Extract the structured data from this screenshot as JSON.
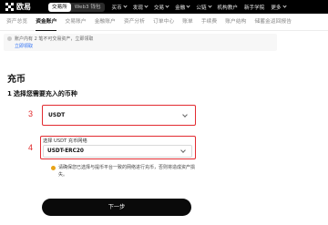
{
  "brand": {
    "name": "欧易"
  },
  "header": {
    "modes": [
      "交易所",
      "Web3 钱包"
    ],
    "nav": [
      {
        "label": "买币",
        "dropdown": true
      },
      {
        "label": "发现",
        "dropdown": true
      },
      {
        "label": "交易",
        "dropdown": true
      },
      {
        "label": "金融",
        "dropdown": true
      },
      {
        "label": "公链",
        "dropdown": true
      },
      {
        "label": "机构教户",
        "dropdown": false
      },
      {
        "label": "新手学院",
        "dropdown": false
      },
      {
        "label": "更多",
        "dropdown": true
      }
    ]
  },
  "subnav": {
    "items": [
      "资产总览",
      "资金账户",
      "交易账户",
      "金融账户",
      "资产分析",
      "订单中心",
      "账单",
      "手续费",
      "账户结构",
      "储蓄金返回报告"
    ],
    "active_index": 1
  },
  "notice": {
    "text": "账户内有 2 笔不可交易资产，立即领取",
    "link": "立即领取"
  },
  "page": {
    "title": "充币"
  },
  "step1": {
    "index": "1",
    "title": "选择您需要充入的币种"
  },
  "coin_select": {
    "value": "USDT"
  },
  "network": {
    "label": "选择 USDT 充币网络",
    "value": "USDT-ERC20"
  },
  "warning": {
    "text": "请确保您已选择与提币平台一致的网络进行充币，否则将造成资产损失。"
  },
  "next_button": {
    "label": "下一步"
  },
  "annotations": {
    "a3": "3",
    "a4": "4"
  }
}
